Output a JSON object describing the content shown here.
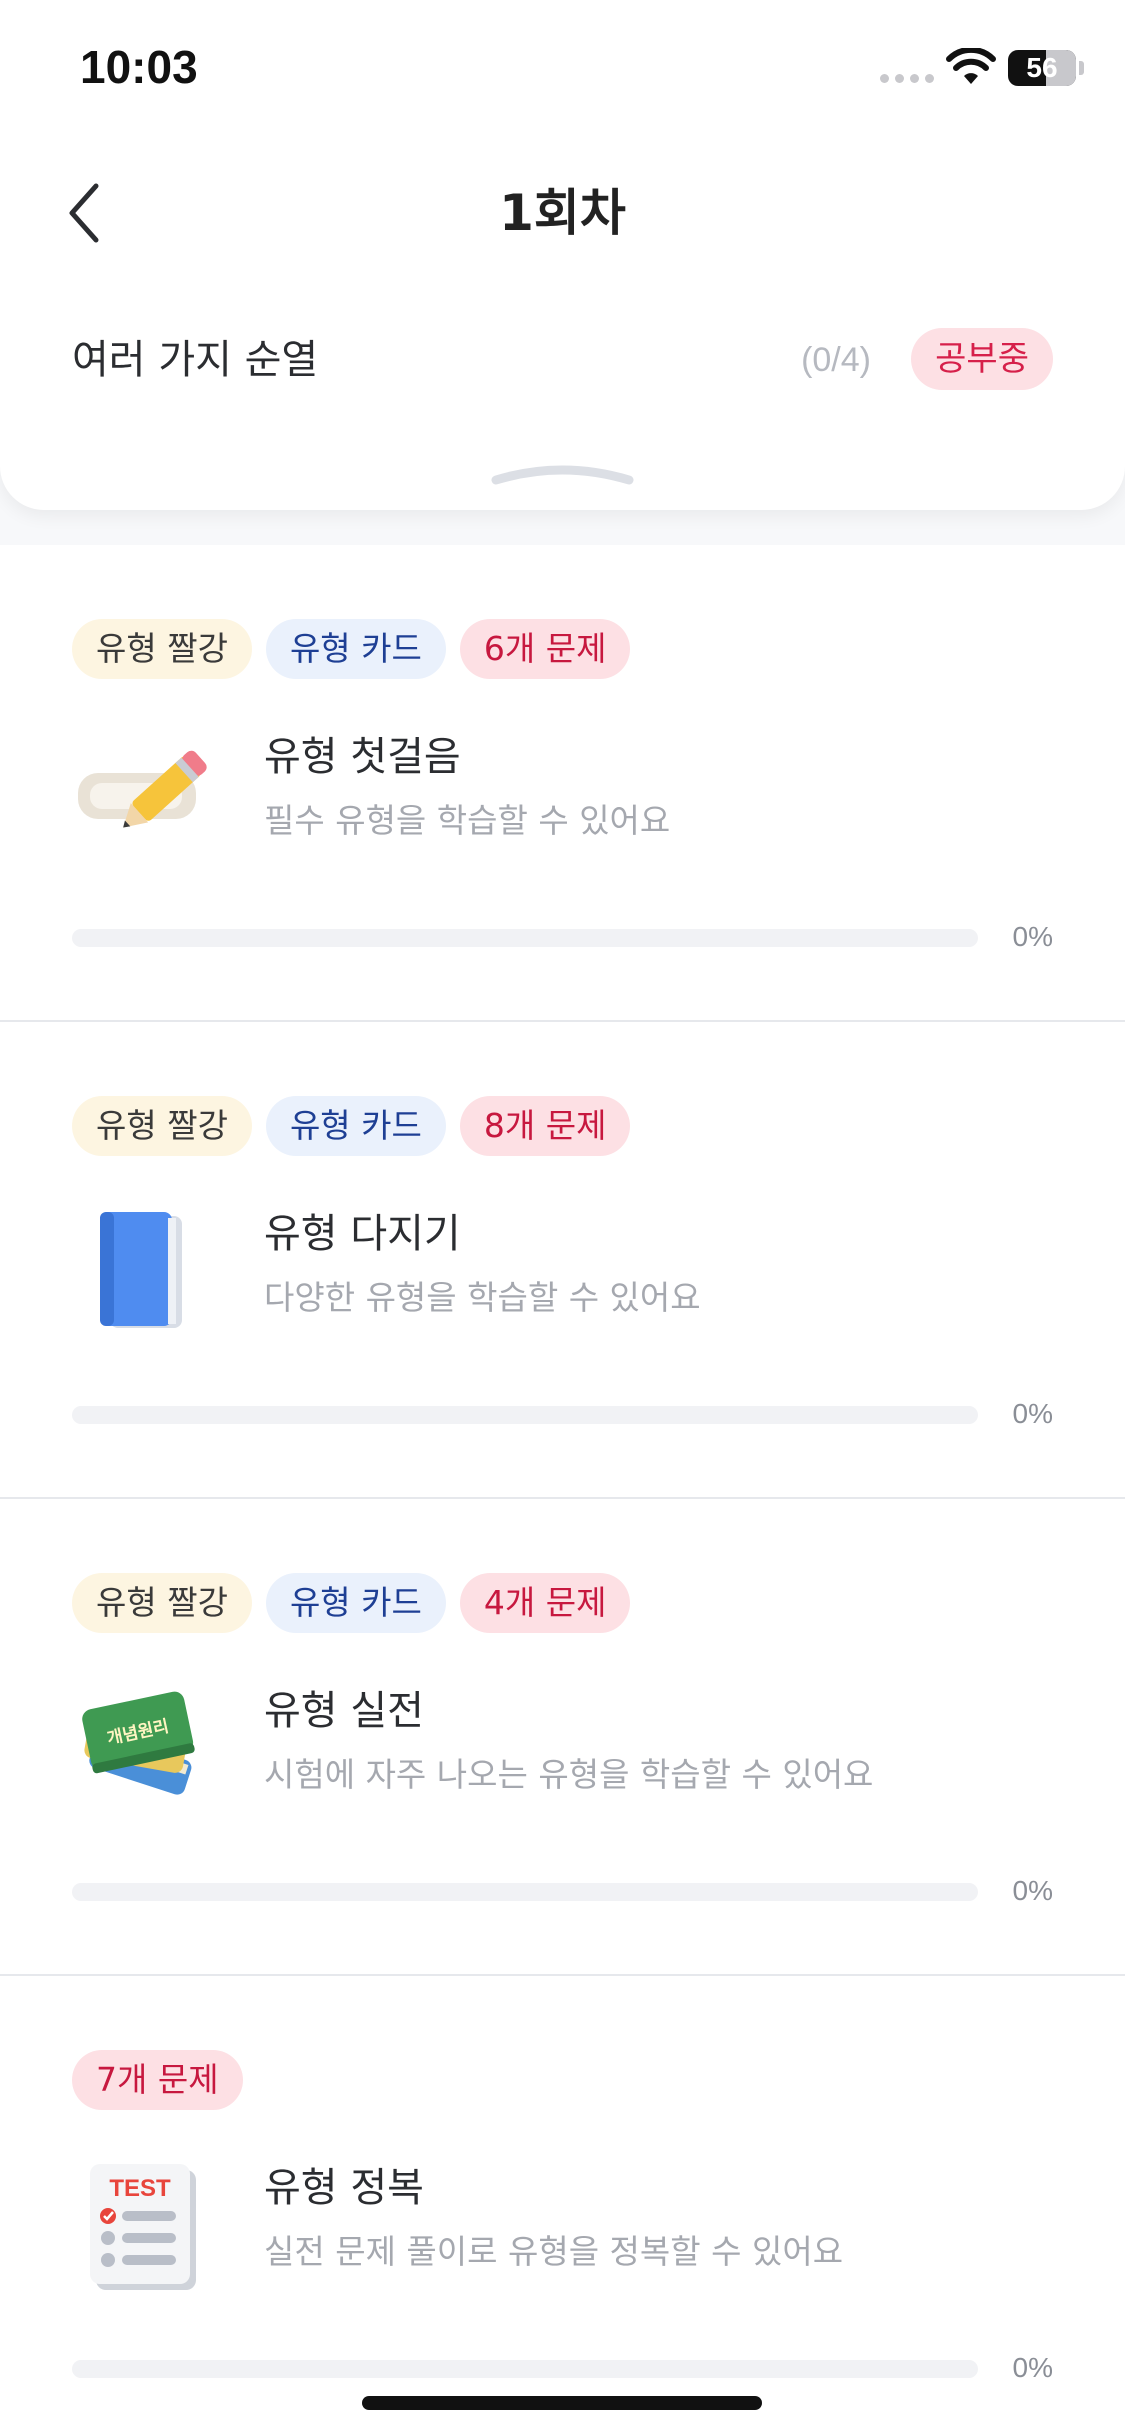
{
  "status_bar": {
    "time": "10:03",
    "battery": "56",
    "battery_level": 0.56
  },
  "nav": {
    "title": "1회차",
    "back_icon": "chevron-left-icon"
  },
  "unit": {
    "title": "여러 가지 순열",
    "progress": "(0/4)",
    "status_badge": "공부중"
  },
  "colors": {
    "accent_red": "#d6204a",
    "tag_blue_text": "#1e3f94",
    "progress_track": "#f1f2f5"
  },
  "cards": [
    {
      "tags": [
        "유형 짤강",
        "유형 카드",
        "6개 문제"
      ],
      "icon": "pencil-eraser-icon",
      "title": "유형 첫걸음",
      "description": "필수 유형을 학습할 수 있어요",
      "progress": 0,
      "progress_label": "0%"
    },
    {
      "tags": [
        "유형 짤강",
        "유형 카드",
        "8개 문제"
      ],
      "icon": "blue-book-icon",
      "title": "유형 다지기",
      "description": "다양한 유형을 학습할 수 있어요",
      "progress": 0,
      "progress_label": "0%"
    },
    {
      "tags": [
        "유형 짤강",
        "유형 카드",
        "4개 문제"
      ],
      "icon": "concept-books-icon",
      "icon_text": "개념원리",
      "title": "유형 실전",
      "description": "시험에 자주 나오는 유형을 학습할 수 있어요",
      "progress": 0,
      "progress_label": "0%"
    },
    {
      "tags": [
        "7개 문제"
      ],
      "icon": "test-paper-icon",
      "icon_text": "TEST",
      "title": "유형 정복",
      "description": "실전 문제 풀이로 유형을 정복할 수 있어요",
      "progress": 0,
      "progress_label": "0%"
    }
  ]
}
